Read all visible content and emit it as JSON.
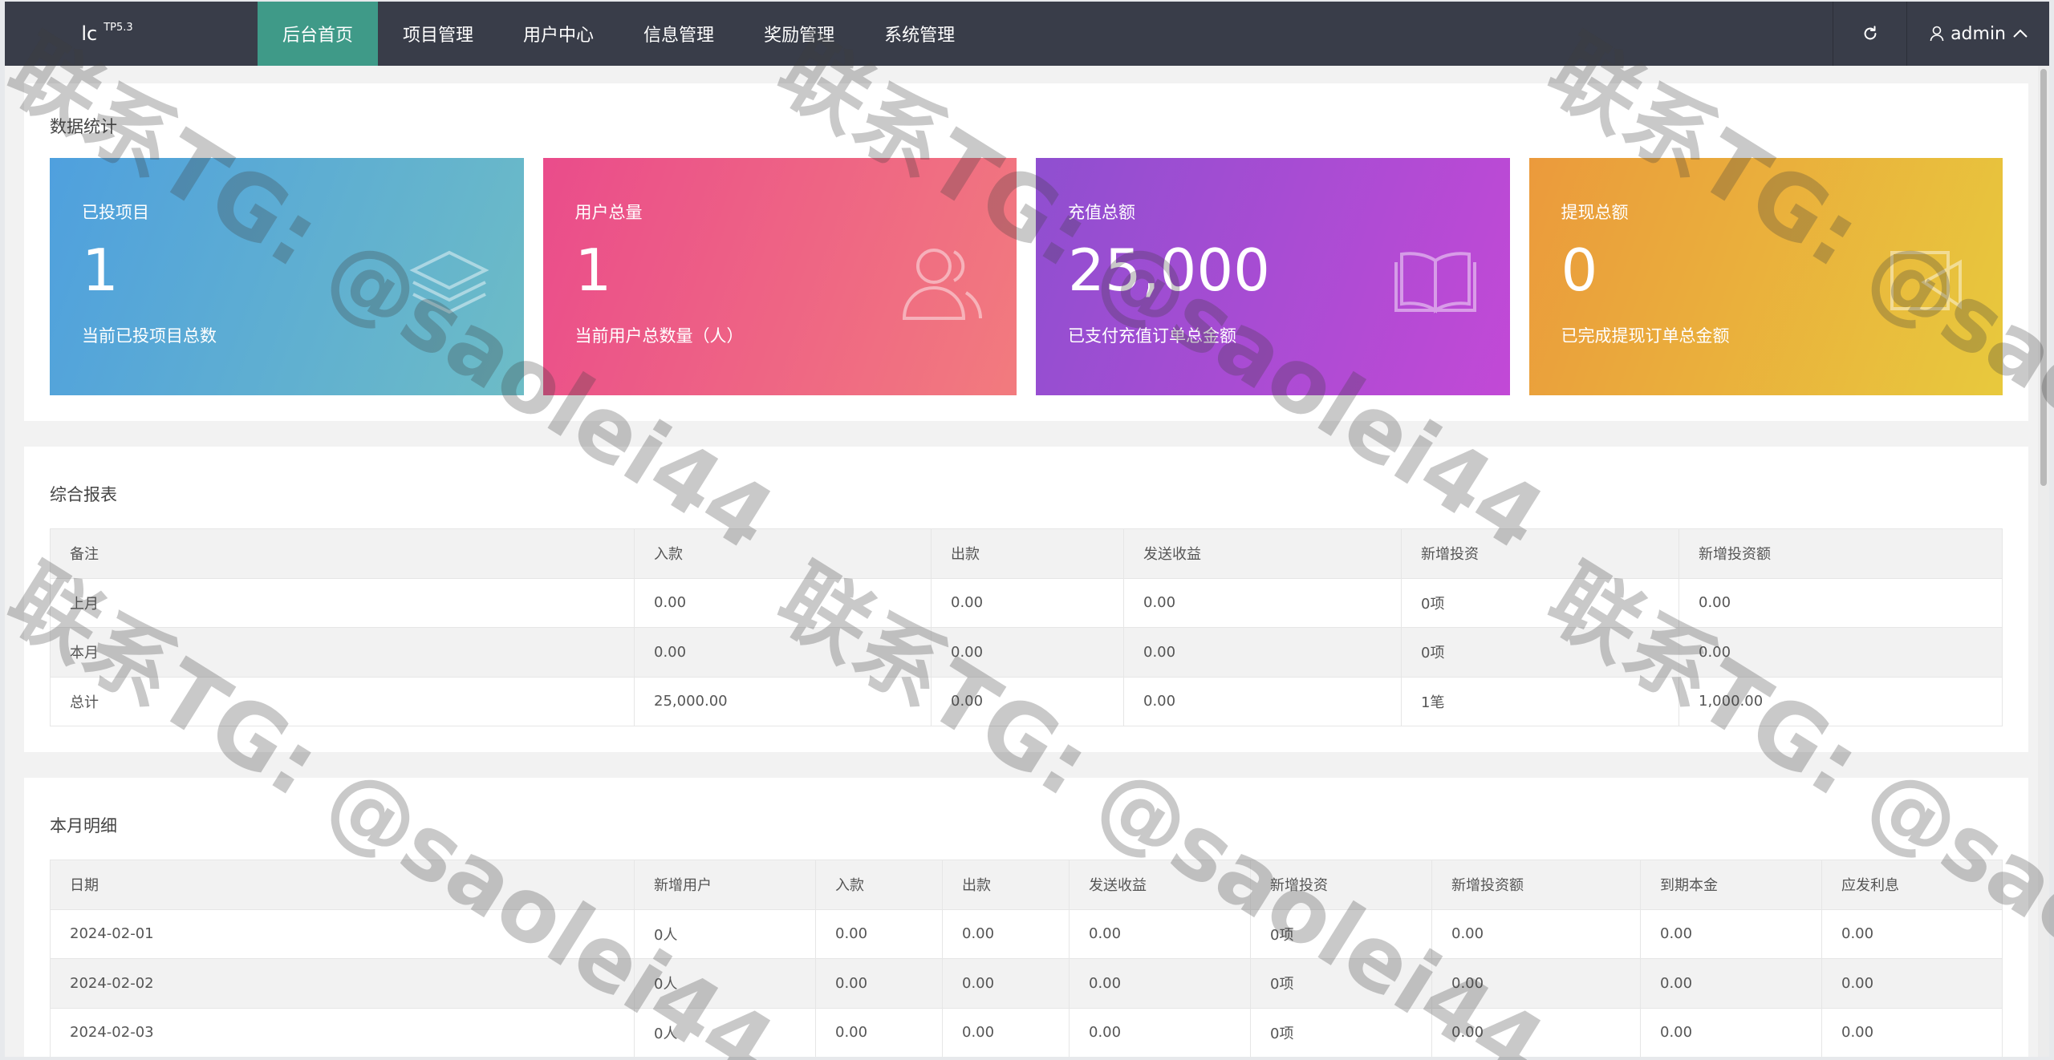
{
  "app": {
    "logo": "lc",
    "version": "TP5.3"
  },
  "nav": [
    {
      "label": "后台首页",
      "active": true
    },
    {
      "label": "项目管理",
      "active": false
    },
    {
      "label": "用户中心",
      "active": false
    },
    {
      "label": "信息管理",
      "active": false
    },
    {
      "label": "奖励管理",
      "active": false
    },
    {
      "label": "系统管理",
      "active": false
    }
  ],
  "toolbar": {
    "refresh_icon": "refresh-icon",
    "user_icon": "user-icon",
    "username": "admin",
    "chevron_icon": "chevron-up-icon"
  },
  "stats": {
    "title": "数据统计",
    "cards": [
      {
        "label": "已投项目",
        "value": "1",
        "desc": "当前已投项目总数",
        "icon": "stack-icon",
        "color": "#4fa0de"
      },
      {
        "label": "用户总量",
        "value": "1",
        "desc": "当前用户总数量（人）",
        "icon": "users-icon",
        "color": "#ea4c8b"
      },
      {
        "label": "充值总额",
        "value": "25,000",
        "desc": "已支付充值订单总金额",
        "icon": "book-icon",
        "color": "#8f4fd0"
      },
      {
        "label": "提现总额",
        "value": "0",
        "desc": "已完成提现订单总金额",
        "icon": "withdraw-icon",
        "color": "#eb9a3c"
      }
    ]
  },
  "report": {
    "title": "综合报表",
    "columns": [
      "备注",
      "入款",
      "出款",
      "发送收益",
      "新增投资",
      "新增投资额"
    ],
    "rows": [
      [
        "上月",
        "0.00",
        "0.00",
        "0.00",
        "0项",
        "0.00"
      ],
      [
        "本月",
        "0.00",
        "0.00",
        "0.00",
        "0项",
        "0.00"
      ],
      [
        "总计",
        "25,000.00",
        "0.00",
        "0.00",
        "1笔",
        "1,000.00"
      ]
    ]
  },
  "monthly": {
    "title": "本月明细",
    "columns": [
      "日期",
      "新增用户",
      "入款",
      "出款",
      "发送收益",
      "新增投资",
      "新增投资额",
      "到期本金",
      "应发利息"
    ],
    "rows": [
      [
        "2024-02-01",
        "0人",
        "0.00",
        "0.00",
        "0.00",
        "0项",
        "0.00",
        "0.00",
        "0.00"
      ],
      [
        "2024-02-02",
        "0人",
        "0.00",
        "0.00",
        "0.00",
        "0项",
        "0.00",
        "0.00",
        "0.00"
      ],
      [
        "2024-02-03",
        "0人",
        "0.00",
        "0.00",
        "0.00",
        "0项",
        "0.00",
        "0.00",
        "0.00"
      ]
    ]
  },
  "watermark": "联系TG: @saolei44"
}
